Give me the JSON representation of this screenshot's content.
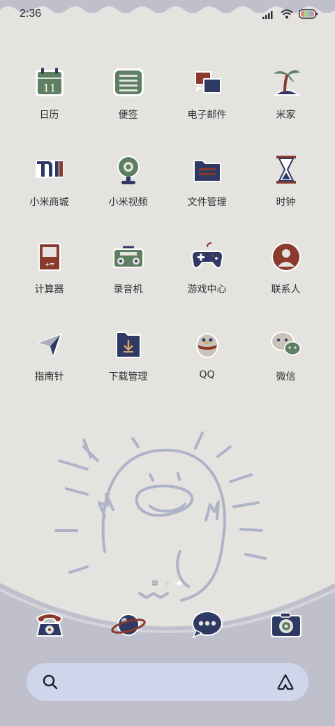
{
  "status_bar": {
    "time": "2:36",
    "icons": [
      "signal-icon",
      "wifi-icon",
      "battery-icon"
    ]
  },
  "apps": [
    {
      "label": "日历",
      "icon": "calendar-icon",
      "badge_text": "11"
    },
    {
      "label": "便签",
      "icon": "notes-icon"
    },
    {
      "label": "电子邮件",
      "icon": "email-icon"
    },
    {
      "label": "米家",
      "icon": "mijia-palm-icon"
    },
    {
      "label": "小米商城",
      "icon": "mi-store-icon"
    },
    {
      "label": "小米视频",
      "icon": "webcam-video-icon"
    },
    {
      "label": "文件管理",
      "icon": "folder-icon"
    },
    {
      "label": "时钟",
      "icon": "hourglass-icon"
    },
    {
      "label": "计算器",
      "icon": "calculator-icon"
    },
    {
      "label": "录音机",
      "icon": "recorder-radio-icon"
    },
    {
      "label": "游戏中心",
      "icon": "gamepad-icon"
    },
    {
      "label": "联系人",
      "icon": "contact-avatar-icon"
    },
    {
      "label": "指南针",
      "icon": "compass-arrow-icon"
    },
    {
      "label": "下载管理",
      "icon": "download-folder-icon"
    },
    {
      "label": "QQ",
      "icon": "qq-penguin-icon"
    },
    {
      "label": "微信",
      "icon": "wechat-icon"
    }
  ],
  "page_indicator": {
    "pages": 3,
    "current": 3
  },
  "dock": [
    {
      "icon": "rotary-phone-icon"
    },
    {
      "icon": "planet-browser-icon"
    },
    {
      "icon": "message-bubble-icon"
    },
    {
      "icon": "camera-icon"
    }
  ],
  "search_bar": {
    "left_icon": "search-icon",
    "right_icon": "assistant-triangle-icon"
  },
  "colors": {
    "wallpaper": "#e4e3df",
    "dock_area": "#bfc0cc",
    "doodle": "#a9aec6",
    "navy": "#2e3a64",
    "red": "#8a3a2c",
    "green": "#5f7f63",
    "search_bg": "#cfd5ea"
  }
}
